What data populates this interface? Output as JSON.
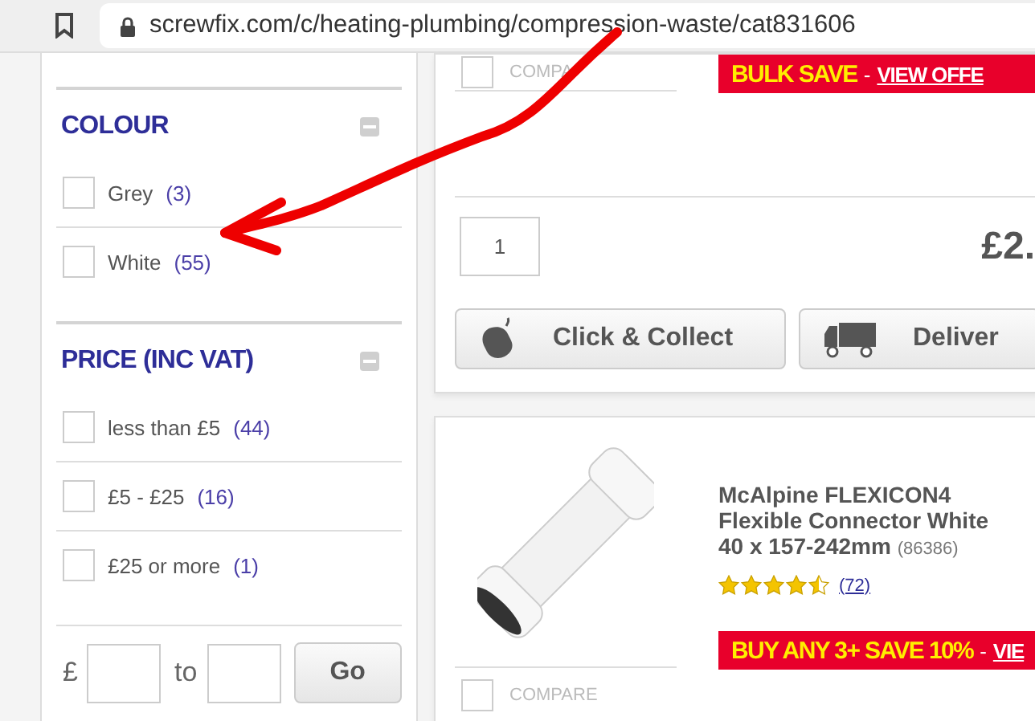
{
  "browser": {
    "url": "screwfix.com/c/heating-plumbing/compression-waste/cat831606"
  },
  "filters": [
    {
      "title": "COLOUR",
      "expanded": true,
      "options": [
        {
          "label": "Grey",
          "count": "(3)",
          "checked": false
        },
        {
          "label": "White",
          "count": "(55)",
          "checked": false
        }
      ]
    },
    {
      "title": "PRICE (INC VAT)",
      "expanded": true,
      "options": [
        {
          "label": "less than £5",
          "count": "(44)",
          "checked": false
        },
        {
          "label": "£5 - £25",
          "count": "(16)",
          "checked": false
        },
        {
          "label": "£25 or more",
          "count": "(1)",
          "checked": false
        }
      ]
    }
  ],
  "price_range": {
    "currency": "£",
    "separator": "to",
    "button": "Go"
  },
  "products": [
    {
      "compare": {
        "label": "COMPA",
        "checked": false
      },
      "promo": {
        "headline": "BULK SAVE",
        "separator": "-",
        "link": "VIEW OFFE"
      },
      "quantity": "1",
      "price": "£2.",
      "buttons": [
        {
          "kind": "collect",
          "label": "Click & Collect"
        },
        {
          "kind": "deliver",
          "label": "Deliver"
        }
      ]
    },
    {
      "title": "McAlpine FLEXICON4 Flexible Connector White 40 x 157-242mm",
      "code": "(86386)",
      "stars": 4.5,
      "reviews": "(72)",
      "promo": {
        "headline": "BUY ANY 3+ SAVE 10%",
        "separator": "-",
        "link": "VIE"
      },
      "compare": {
        "label": "COMPARE",
        "checked": false
      }
    }
  ]
}
